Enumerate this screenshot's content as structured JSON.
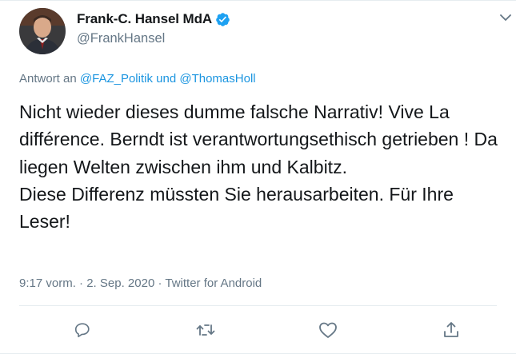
{
  "author": {
    "display_name": "Frank-C. Hansel MdA",
    "handle": "@FrankHansel",
    "verified": true
  },
  "reply_to": {
    "prefix": "Antwort an",
    "mention1": "@FAZ_Politik",
    "conj": "und",
    "mention2": "@ThomasHoll"
  },
  "tweet": {
    "text": "Nicht wieder dieses dumme falsche Narrativ! Vive La différence. Berndt ist verantwortungsethisch getrieben ! Da liegen Welten zwischen ihm und Kalbitz.\nDiese Differenz müssten Sie herausarbeiten. Für Ihre Leser!"
  },
  "meta": {
    "time": "9:17 vorm.",
    "date": "2. Sep. 2020",
    "source": "Twitter for Android",
    "separator": "·"
  },
  "colors": {
    "accent": "#1da1f2",
    "muted": "#657786",
    "text": "#14171a"
  },
  "icons": [
    "verified-badge-icon",
    "chevron-down-icon",
    "reply-icon",
    "retweet-icon",
    "like-icon",
    "share-icon"
  ]
}
